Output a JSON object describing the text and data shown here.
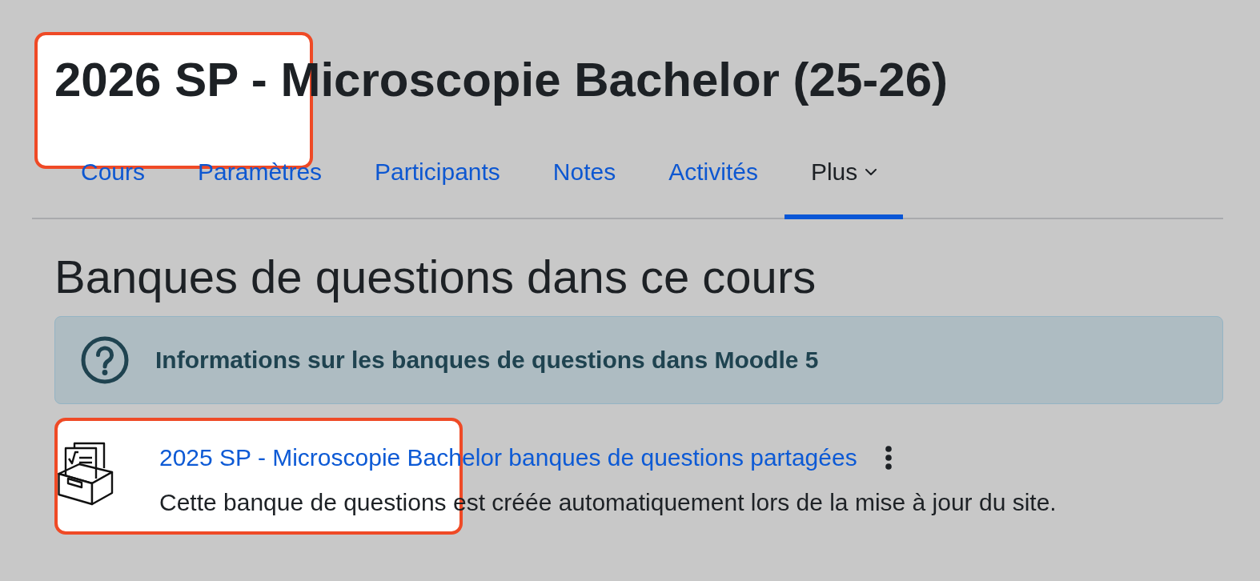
{
  "page": {
    "title": "2026 SP - Microscopie Bachelor (25-26)"
  },
  "tabs": [
    {
      "label": "Cours",
      "selected": false,
      "kind": "link"
    },
    {
      "label": "Paramètres",
      "selected": false,
      "kind": "link"
    },
    {
      "label": "Participants",
      "selected": false,
      "kind": "link"
    },
    {
      "label": "Notes",
      "selected": false,
      "kind": "link"
    },
    {
      "label": "Activités",
      "selected": false,
      "kind": "link"
    },
    {
      "label": "Plus",
      "selected": true,
      "kind": "menu"
    }
  ],
  "heading": "Banques de questions dans ce cours",
  "info_alert": {
    "text": "Informations sur les banques de questions dans Moodle 5"
  },
  "question_banks": [
    {
      "name": "2025 SP - Microscopie Bachelor banques de questions partagées",
      "description": "Cette banque de questions est créée automatiquement lors de la mise à jour du site."
    }
  ]
}
